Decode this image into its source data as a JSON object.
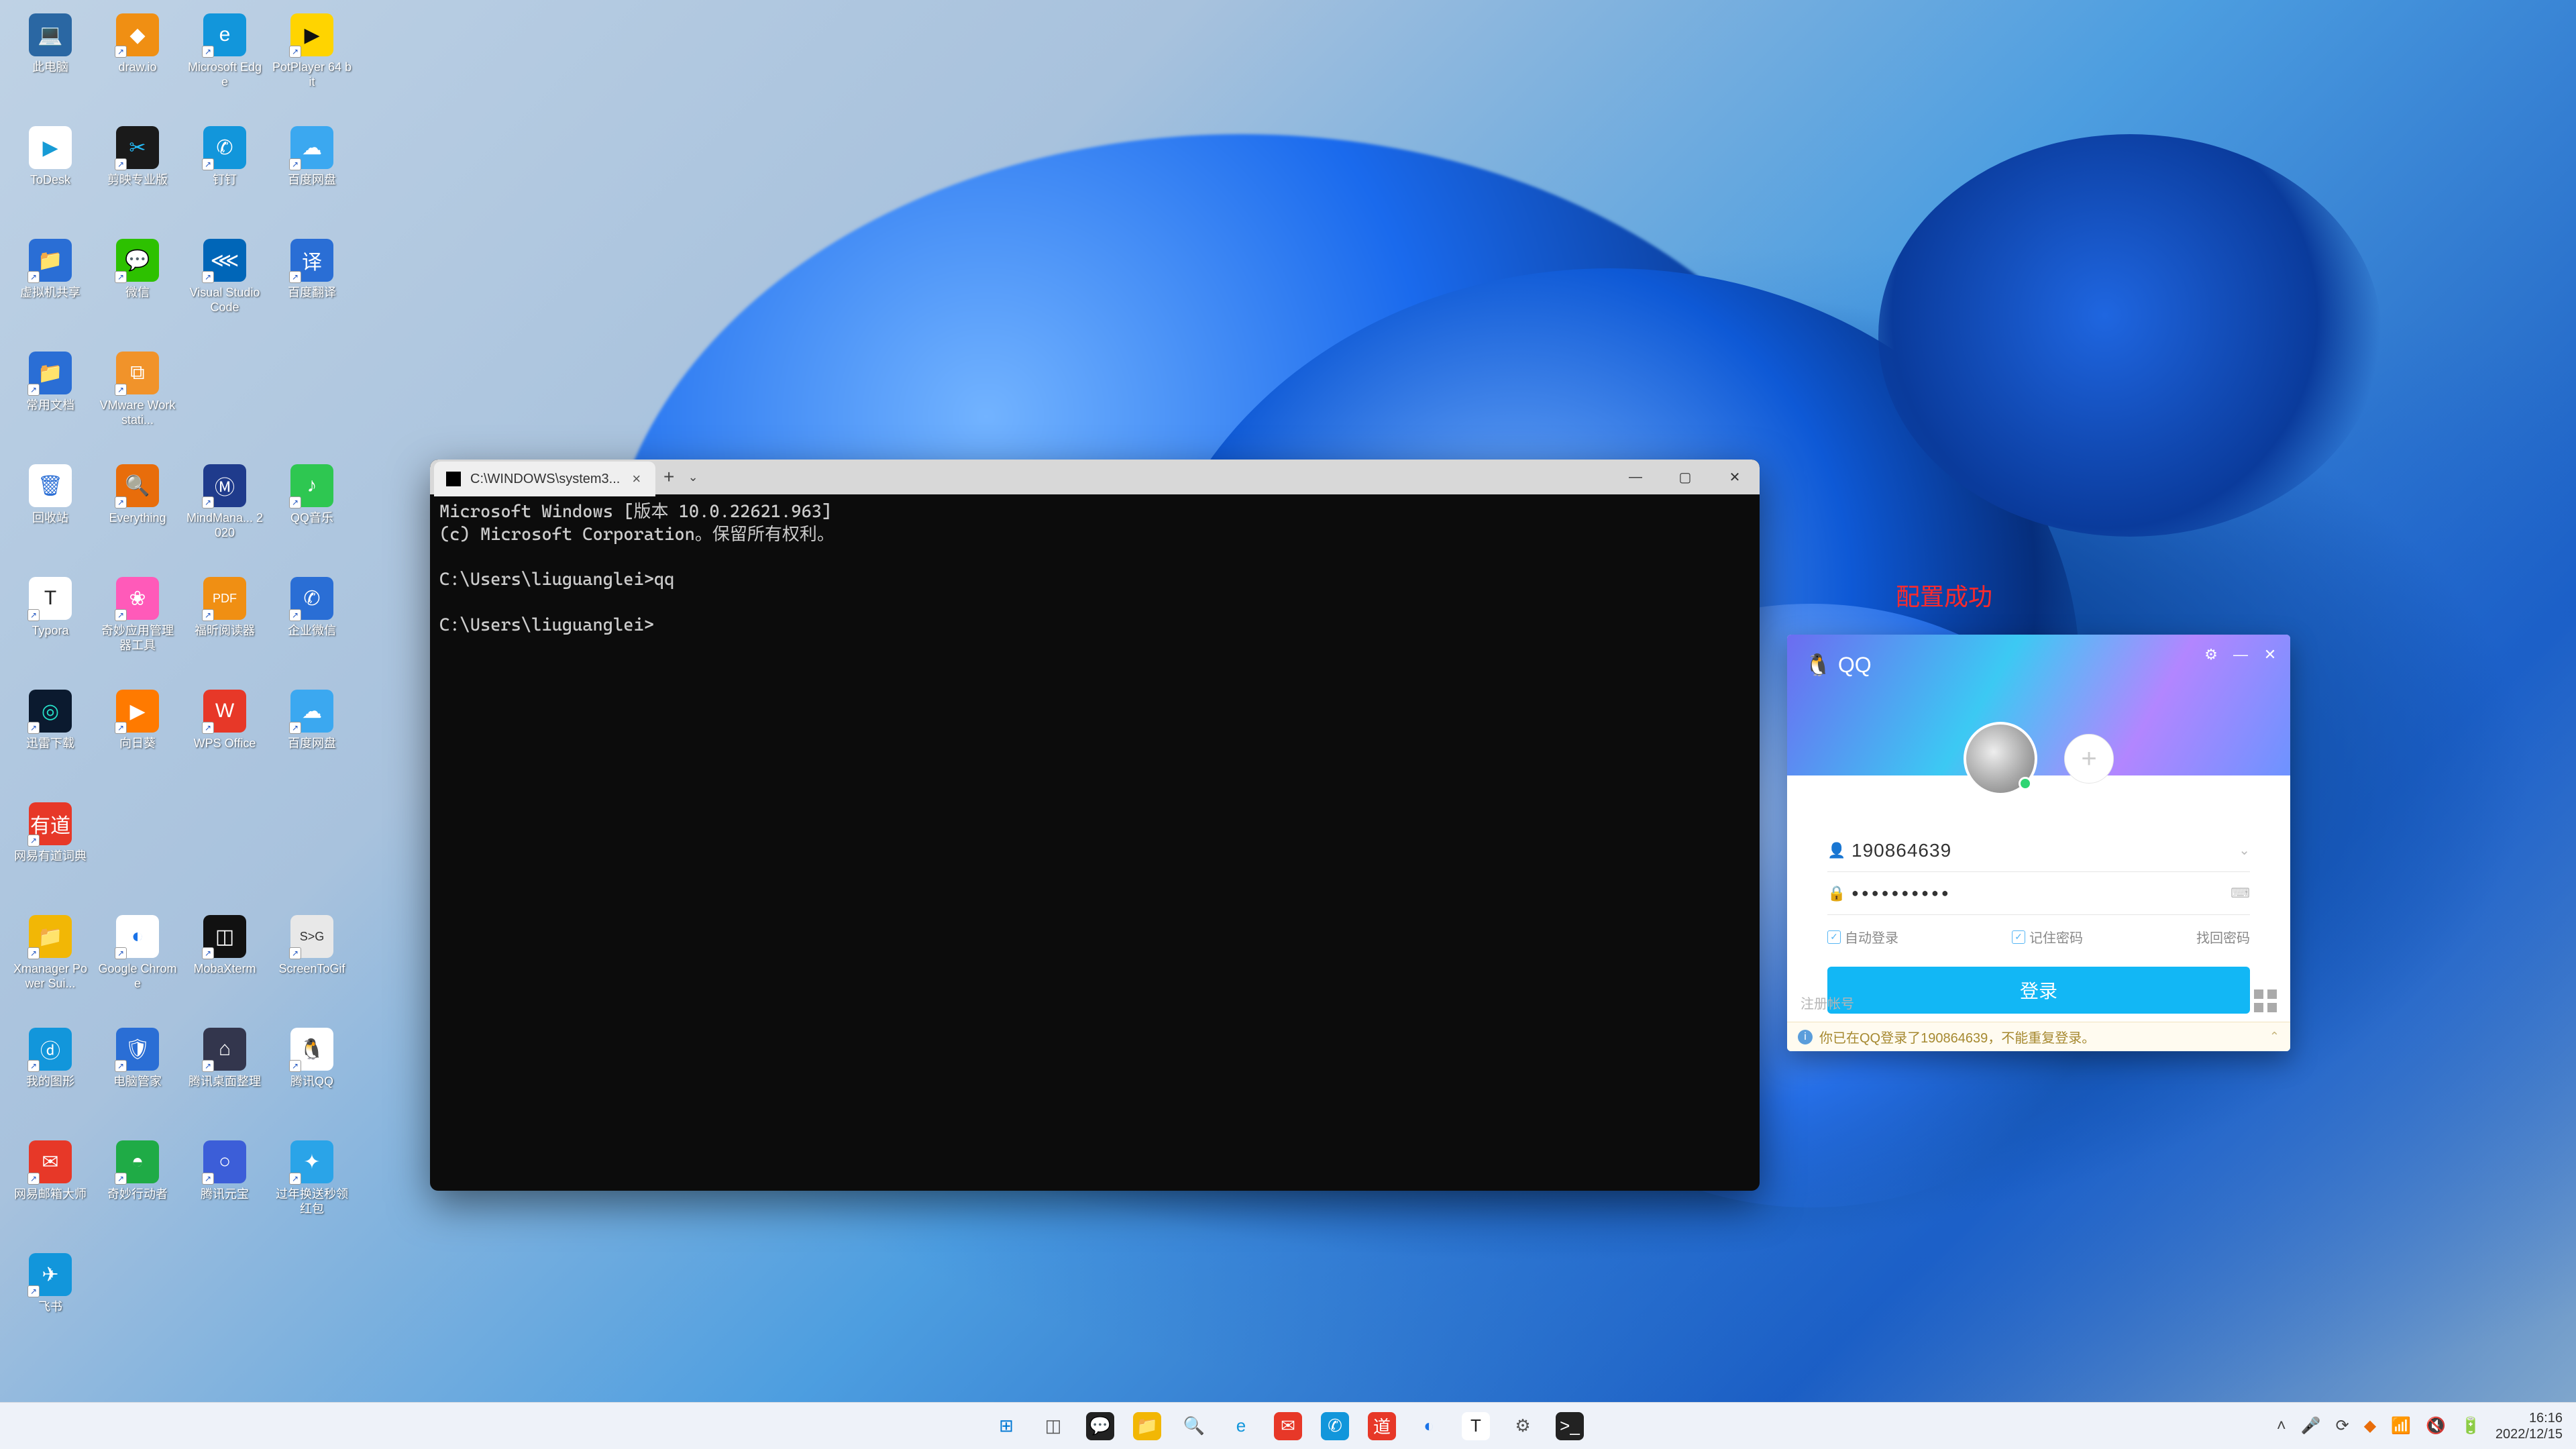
{
  "desktop_icons": [
    {
      "label": "此电脑",
      "bg": "#2a67a3",
      "glyph": "💻",
      "shortcut": false
    },
    {
      "label": "ToDesk",
      "bg": "#ffffff",
      "glyph": "▶",
      "fg": "#169bd5",
      "shortcut": false
    },
    {
      "label": "虚拟机共享",
      "bg": "#2a6ed5",
      "glyph": "📁",
      "shortcut": true
    },
    {
      "label": "常用文档",
      "bg": "#2a6ed5",
      "glyph": "📁",
      "shortcut": true
    },
    {
      "label": "回收站",
      "bg": "#ffffff",
      "glyph": "🗑",
      "fg": "#2a6ed5",
      "shortcut": false
    },
    {
      "label": "Typora",
      "bg": "#ffffff",
      "glyph": "T",
      "fg": "#222",
      "shortcut": true
    },
    {
      "label": "迅雷下载",
      "bg": "#0b1a2f",
      "glyph": "◎",
      "fg": "#26e0c8",
      "shortcut": true
    },
    {
      "label": "网易有道词典",
      "bg": "#e73828",
      "glyph": "有道",
      "shortcut": true
    },
    {
      "label": "Xmanager Power Sui...",
      "bg": "#f2b705",
      "glyph": "📁",
      "shortcut": true
    },
    {
      "label": "我的图形",
      "bg": "#1296db",
      "glyph": "ⓓ",
      "shortcut": true
    },
    {
      "label": "网易邮箱大师",
      "bg": "#e73828",
      "glyph": "✉",
      "shortcut": true
    },
    {
      "label": "飞书",
      "bg": "#1296db",
      "glyph": "✈",
      "shortcut": true
    },
    {
      "label": "draw.io",
      "bg": "#f08f13",
      "glyph": "◆",
      "shortcut": true
    },
    {
      "label": "剪映专业版",
      "bg": "#1a1a1a",
      "glyph": "✂",
      "fg": "#26c0ff",
      "shortcut": true
    },
    {
      "label": "微信",
      "bg": "#2dc100",
      "glyph": "💬",
      "shortcut": true
    },
    {
      "label": "VMware Workstati...",
      "bg": "#f1932a",
      "glyph": "⧉",
      "shortcut": true
    },
    {
      "label": "Everything",
      "bg": "#e86d0b",
      "glyph": "🔍",
      "shortcut": true
    },
    {
      "label": "奇妙应用管理器工具",
      "bg": "#ff5ab9",
      "glyph": "❀",
      "shortcut": true
    },
    {
      "label": "向日葵",
      "bg": "#ff7a00",
      "glyph": "▶",
      "shortcut": true
    },
    {
      "label": "",
      "bg": "",
      "glyph": "",
      "hidden": true
    },
    {
      "label": "Google Chrome",
      "bg": "#fff",
      "glyph": "◐",
      "fg": "#1a73e8",
      "shortcut": true
    },
    {
      "label": "电脑管家",
      "bg": "#2a6ed5",
      "glyph": "🛡",
      "shortcut": true
    },
    {
      "label": "奇妙行动者",
      "bg": "#1fab46",
      "glyph": "◓",
      "shortcut": true
    },
    {
      "label": "",
      "bg": "",
      "glyph": "",
      "hidden": true
    },
    {
      "label": "Microsoft Edge",
      "bg": "#1296db",
      "glyph": "e",
      "shortcut": true
    },
    {
      "label": "钉钉",
      "bg": "#1296db",
      "glyph": "✆",
      "shortcut": true
    },
    {
      "label": "Visual Studio Code",
      "bg": "#0066b8",
      "glyph": "⋘",
      "shortcut": true
    },
    {
      "label": "",
      "bg": "",
      "glyph": "",
      "hidden": true
    },
    {
      "label": "MindMana... 2020",
      "bg": "#1f3b8c",
      "glyph": "Ⓜ",
      "shortcut": true
    },
    {
      "label": "福昕阅读器",
      "bg": "#f08f13",
      "glyph": "PDF",
      "shortcut": true
    },
    {
      "label": "WPS Office",
      "bg": "#e73828",
      "glyph": "W",
      "shortcut": true
    },
    {
      "label": "",
      "bg": "",
      "glyph": "",
      "hidden": true
    },
    {
      "label": "MobaXterm",
      "bg": "#111",
      "glyph": "◫",
      "shortcut": true
    },
    {
      "label": "腾讯桌面整理",
      "bg": "#33364d",
      "glyph": "⌂",
      "shortcut": true
    },
    {
      "label": "腾讯元宝",
      "bg": "#3c5ed8",
      "glyph": "○",
      "shortcut": true
    },
    {
      "label": "",
      "bg": "",
      "glyph": "",
      "hidden": true
    },
    {
      "label": "PotPlayer 64 bit",
      "bg": "#ffd400",
      "glyph": "▶",
      "fg": "#111",
      "shortcut": true
    },
    {
      "label": "百度网盘",
      "bg": "#3ba8f0",
      "glyph": "☁",
      "shortcut": true
    },
    {
      "label": "百度翻译",
      "bg": "#2a6ed5",
      "glyph": "译",
      "shortcut": true
    },
    {
      "label": "",
      "bg": "",
      "glyph": "",
      "hidden": true
    },
    {
      "label": "QQ音乐",
      "bg": "#2ec751",
      "glyph": "♪",
      "shortcut": true
    },
    {
      "label": "企业微信",
      "bg": "#2a6ed5",
      "glyph": "✆",
      "shortcut": true
    },
    {
      "label": "百度网盘",
      "bg": "#3ba8f0",
      "glyph": "☁",
      "shortcut": true
    },
    {
      "label": "",
      "bg": "",
      "glyph": "",
      "hidden": true
    },
    {
      "label": "ScreenToGif",
      "bg": "#e8e8e8",
      "glyph": "S>G",
      "fg": "#333",
      "shortcut": true
    },
    {
      "label": "腾讯QQ",
      "bg": "#fff",
      "glyph": "🐧",
      "fg": "#111",
      "shortcut": true
    },
    {
      "label": "过年换送秒领红包",
      "bg": "#2aa4e8",
      "glyph": "✦",
      "shortcut": true
    }
  ],
  "terminal": {
    "tab_title": "C:\\WINDOWS\\system3...",
    "lines": [
      "Microsoft Windows [版本 10.0.22621.963]",
      "(c) Microsoft Corporation。保留所有权利。",
      "",
      "C:\\Users\\liuguanglei>qq",
      "",
      "C:\\Users\\liuguanglei>"
    ]
  },
  "annotation": "配置成功",
  "qq": {
    "title": "QQ",
    "account": "190864639",
    "password_mask": "●●●●●●●●●●",
    "auto_login": "自动登录",
    "remember_pwd": "记住密码",
    "find_pwd": "找回密码",
    "login_btn": "登录",
    "register": "注册帐号",
    "footer_msg": "你已在QQ登录了190864639，不能重复登录。"
  },
  "taskbar": {
    "icons": [
      {
        "name": "start",
        "bg": "transparent",
        "glyph": "⊞",
        "fg": "#0078d4"
      },
      {
        "name": "task-view",
        "bg": "transparent",
        "glyph": "◫",
        "fg": "#555"
      },
      {
        "name": "chat",
        "bg": "#222",
        "glyph": "💬",
        "fg": "#fff"
      },
      {
        "name": "file-explorer",
        "bg": "#f2b705",
        "glyph": "📁"
      },
      {
        "name": "search",
        "bg": "transparent",
        "glyph": "🔍",
        "fg": "#e07000"
      },
      {
        "name": "edge",
        "bg": "transparent",
        "glyph": "e",
        "fg": "#1296db"
      },
      {
        "name": "mail",
        "bg": "#e73828",
        "glyph": "✉"
      },
      {
        "name": "dingding",
        "bg": "#1296db",
        "glyph": "✆"
      },
      {
        "name": "youdao",
        "bg": "#e73828",
        "glyph": "道"
      },
      {
        "name": "chrome",
        "bg": "transparent",
        "glyph": "◐",
        "fg": "#1a73e8"
      },
      {
        "name": "typora",
        "bg": "#fff",
        "glyph": "T",
        "fg": "#222"
      },
      {
        "name": "settings",
        "bg": "transparent",
        "glyph": "⚙",
        "fg": "#555"
      },
      {
        "name": "terminal",
        "bg": "#222",
        "glyph": ">_",
        "fg": "#fff"
      }
    ],
    "tray": {
      "chevron": "˄",
      "time": "16:16",
      "date": "2022/12/15"
    }
  }
}
